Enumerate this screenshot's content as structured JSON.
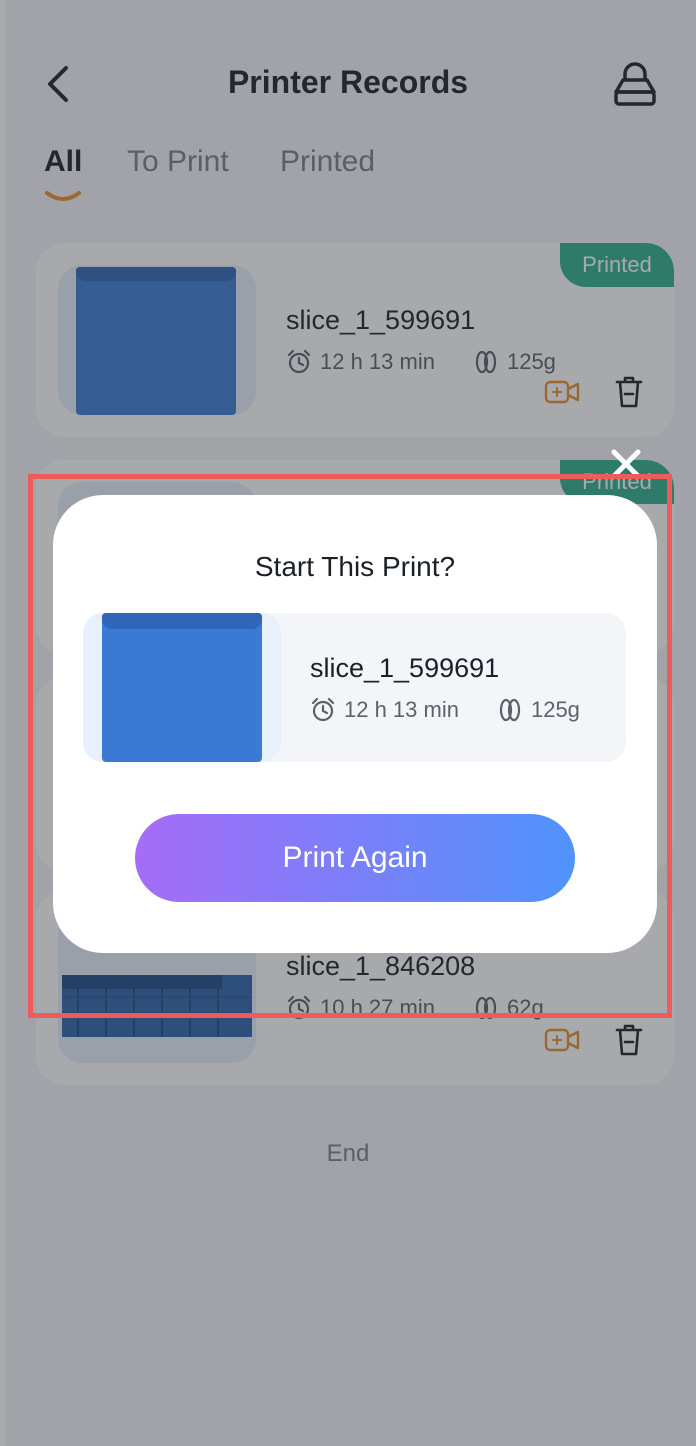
{
  "header": {
    "title": "Printer Records"
  },
  "tabs": [
    {
      "label": "All",
      "active": true
    },
    {
      "label": "To Print",
      "active": false
    },
    {
      "label": "Printed",
      "active": false
    }
  ],
  "records": [
    {
      "status": "Printed",
      "name": "slice_1_599691",
      "time": "12 h 13 min",
      "weight": "125g"
    },
    {
      "status": "Printed",
      "name": "",
      "time": "",
      "weight": ""
    },
    {
      "status": "",
      "name": "",
      "time": "",
      "weight": ""
    },
    {
      "status": "",
      "name": "slice_1_846208",
      "time": "10 h 27 min",
      "weight": "62g"
    }
  ],
  "end_text": "End",
  "dialog": {
    "title": "Start This Print?",
    "name": "slice_1_599691",
    "time": "12 h 13 min",
    "weight": "125g",
    "button_label": "Print Again"
  },
  "colors": {
    "accent_orange": "#e8902a",
    "badge_green": "#2fb08e",
    "button_gradient_start": "#a66cf7",
    "button_gradient_end": "#4f93fb",
    "highlight_red": "#ef5a5a"
  },
  "icons": [
    "back-arrow-icon",
    "printer-icon",
    "alarm-clock-icon",
    "filament-spool-icon",
    "video-camera-icon",
    "trash-icon",
    "close-icon"
  ]
}
